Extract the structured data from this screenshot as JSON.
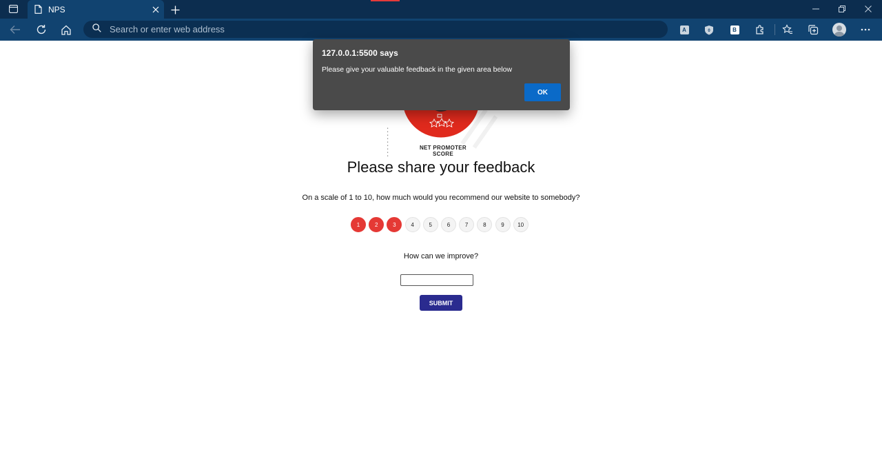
{
  "browser": {
    "tab_title": "NPS",
    "address_placeholder": "Search or enter web address"
  },
  "dialog": {
    "title": "127.0.0.1:5500 says",
    "message": "Please give your valuable feedback in the given area below",
    "ok_label": "OK"
  },
  "page": {
    "logo_caption": "NET PROMOTER SCORE",
    "title": "Please share your feedback",
    "question": "On a scale of 1 to 10, how much would you recommend our website to somebody?",
    "scale": [
      {
        "label": "1",
        "selected": true
      },
      {
        "label": "2",
        "selected": true
      },
      {
        "label": "3",
        "selected": true
      },
      {
        "label": "4",
        "selected": false
      },
      {
        "label": "5",
        "selected": false
      },
      {
        "label": "6",
        "selected": false
      },
      {
        "label": "7",
        "selected": false
      },
      {
        "label": "8",
        "selected": false
      },
      {
        "label": "9",
        "selected": false
      },
      {
        "label": "10",
        "selected": false
      }
    ],
    "improve_label": "How can we improve?",
    "feedback_value": "",
    "submit_label": "SUBMIT"
  },
  "colors": {
    "selected_rating": "#e53935",
    "submit_button": "#2a2b8f",
    "dialog_ok": "#0a6ac8"
  }
}
